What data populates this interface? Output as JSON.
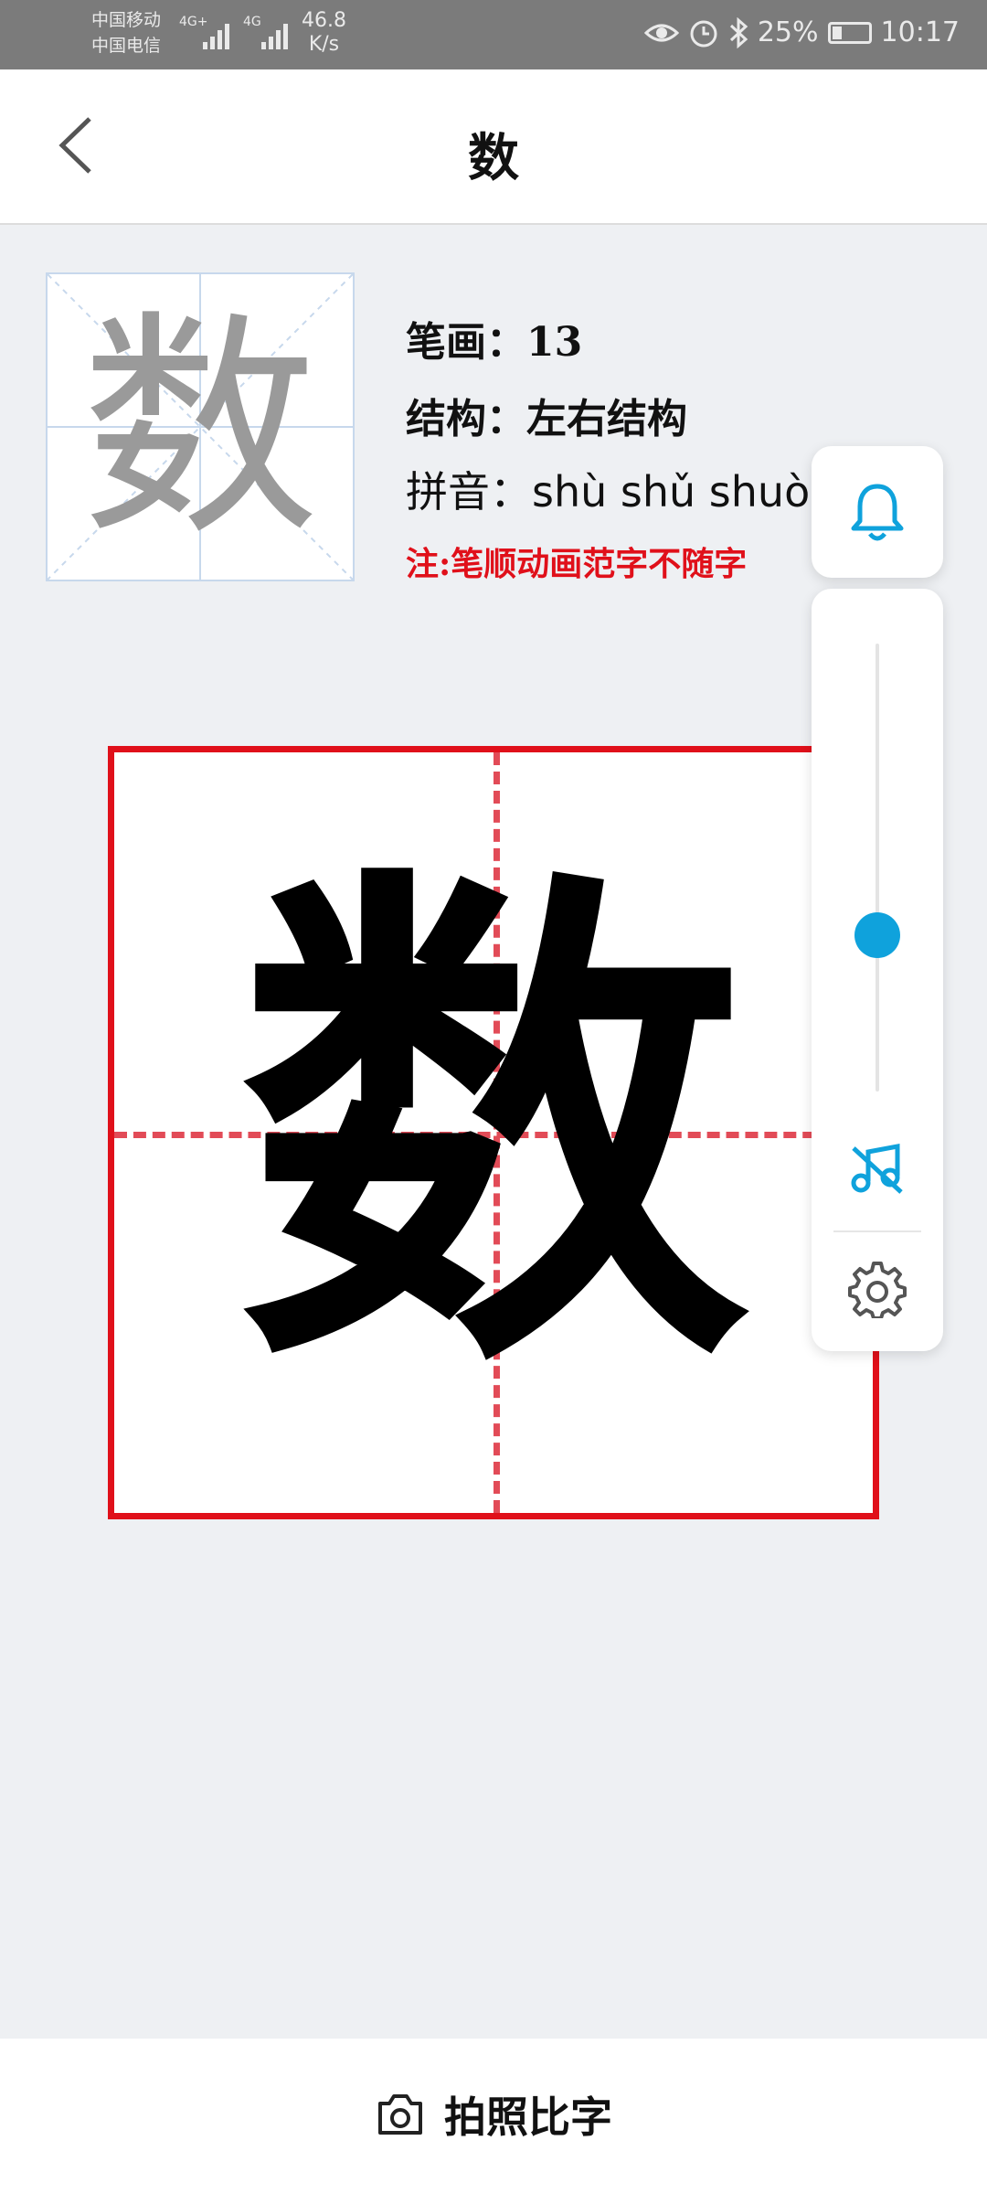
{
  "status_bar": {
    "carrier1": "中国移动",
    "carrier2": "中国电信",
    "net1": "4G+",
    "net2": "4G",
    "speed_value": "46.8",
    "speed_unit": "K/s",
    "battery": "25%",
    "battery_level": 0.25,
    "time": "10:17",
    "icons": [
      "eye-icon",
      "alarm-icon",
      "bluetooth-icon",
      "battery-icon"
    ]
  },
  "nav": {
    "title": "数",
    "back_icon": "chevron-left-icon"
  },
  "reference": {
    "char": "数"
  },
  "info": {
    "strokes_label": "笔画：",
    "strokes_value": "13",
    "structure_label": "结构：",
    "structure_value": "左右结构",
    "pinyin_label": "拼音：",
    "pinyin_value": "shù shǔ shuò",
    "note": "注:笔顺动画范字不随字"
  },
  "grid": {
    "char": "数"
  },
  "side_panel": {
    "bell_icon": "bell-icon",
    "volume_level": 0.35,
    "mute_icon": "music-off-icon",
    "settings_icon": "gear-icon",
    "accent_color": "#0fa2dc"
  },
  "bottom": {
    "camera_icon": "camera-icon",
    "label": "拍照比字"
  },
  "colors": {
    "grid_red": "#e0101a",
    "note_red": "#e0101a",
    "background": "#eef0f3"
  }
}
